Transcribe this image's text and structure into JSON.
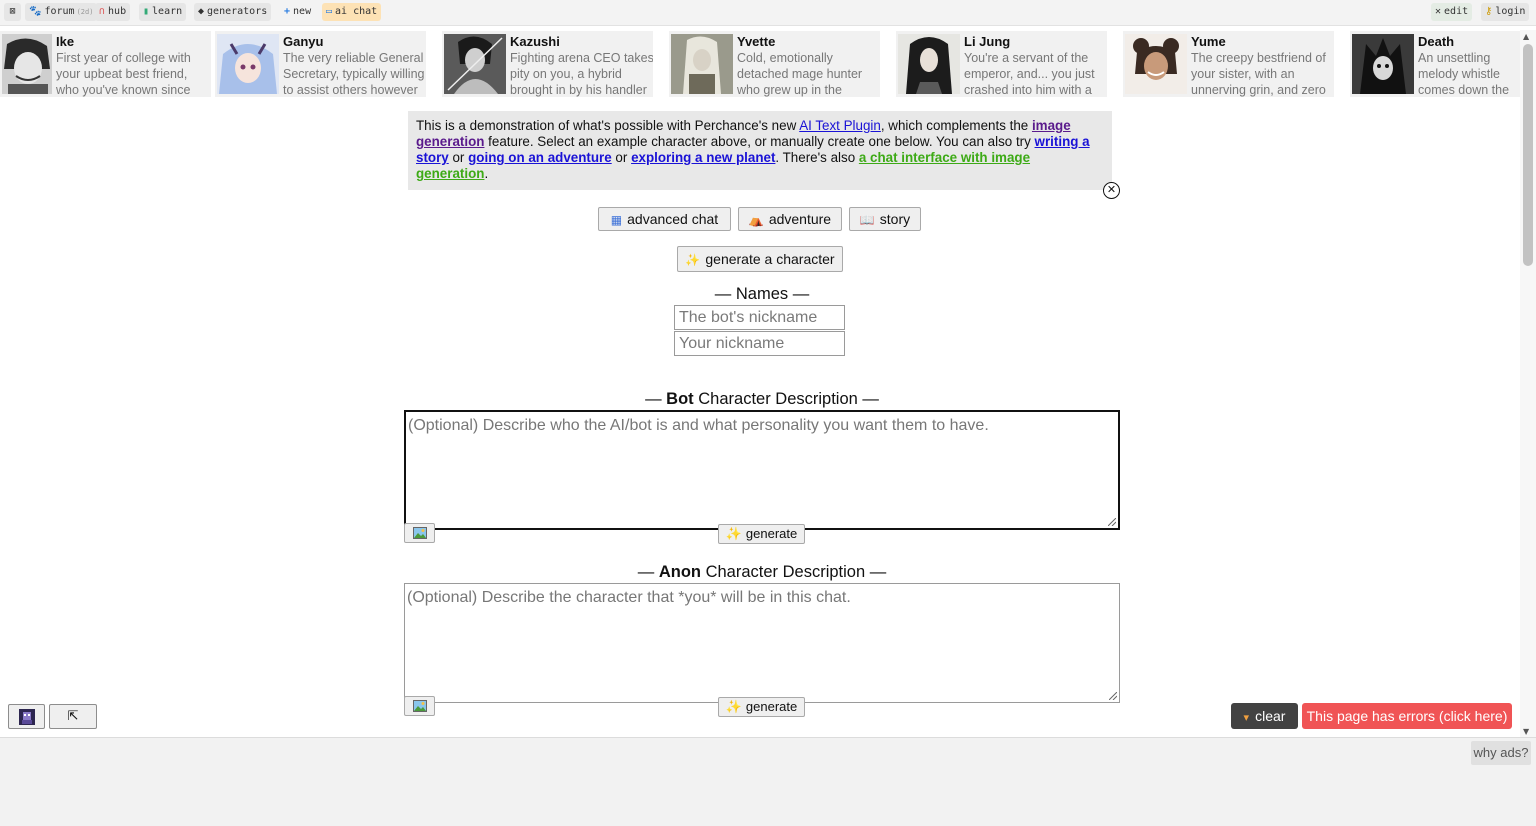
{
  "topbar": {
    "menu_icon": "square-x-icon",
    "forum": {
      "label": "forum",
      "count": "(2d)"
    },
    "hub": "hub",
    "learn": "learn",
    "generators": "generators",
    "new": "new",
    "ai_chat": "ai chat",
    "edit": "edit",
    "login": "login"
  },
  "characters": [
    {
      "name": "Ike",
      "desc": "First year of college with your upbeat best friend, who you've known since"
    },
    {
      "name": "Ganyu",
      "desc": "The very reliable General Secretary, typically willing to assist others however"
    },
    {
      "name": "Kazushi",
      "desc": "Fighting arena CEO takes pity on you, a hybrid brought in by his handler"
    },
    {
      "name": "Yvette",
      "desc": "Cold, emotionally detached mage hunter who grew up in the"
    },
    {
      "name": "Li Jung",
      "desc": "You're a servant of the emperor, and... you just crashed into him with a"
    },
    {
      "name": "Yume",
      "desc": "The creepy bestfriend of your sister, with an unnerving grin, and zero"
    },
    {
      "name": "Death",
      "desc": "An unsettling melody whistle comes down the alley - he has finally"
    }
  ],
  "info": {
    "t1": "This is a demonstration of what's possible with Perchance's new ",
    "link_ai_text": "AI Text Plugin",
    "t2": ", which complements the ",
    "link_image_gen": "image generation",
    "t3": " feature. Select an example character above, or manually create one below. You can also try ",
    "link_story": "writing a story",
    "t4": " or ",
    "link_adventure": "going on an adventure",
    "t5": " or ",
    "link_planet": "exploring a new planet",
    "t6": ". There's also ",
    "link_chat_image": "a chat interface with image generation",
    "t7": "."
  },
  "modes": {
    "advanced_chat": "advanced chat",
    "adventure": "adventure",
    "story": "story"
  },
  "generate_character": "generate a character",
  "names": {
    "title": "— Names —",
    "bot_placeholder": "The bot's nickname",
    "user_placeholder": "Your nickname"
  },
  "bot_desc": {
    "dash_l": "— ",
    "bold": "Bot",
    "rest": " Character Description —",
    "placeholder": "(Optional) Describe who the AI/bot is and what personality you want them to have.",
    "generate": "generate"
  },
  "anon_desc": {
    "dash_l": "— ",
    "bold": "Anon",
    "rest": " Character Description —",
    "placeholder": "(Optional) Describe the character that *you* will be in this chat.",
    "generate": "generate"
  },
  "bottom": {
    "clear": "clear",
    "errors": "This page has errors (click here)",
    "why_ads": "why ads?"
  }
}
